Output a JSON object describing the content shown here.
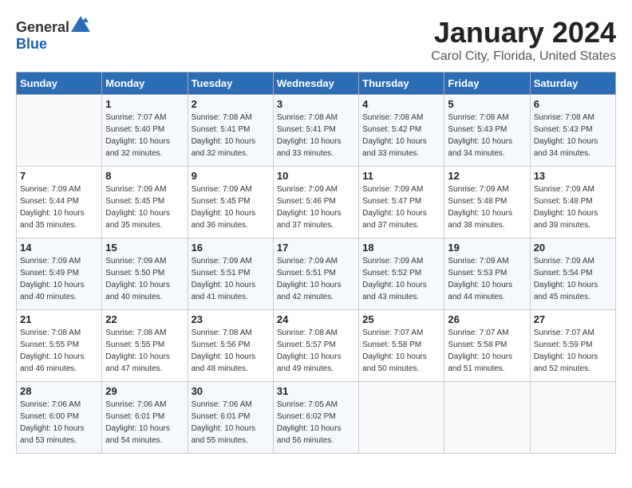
{
  "header": {
    "logo_general": "General",
    "logo_blue": "Blue",
    "month": "January 2024",
    "location": "Carol City, Florida, United States"
  },
  "weekdays": [
    "Sunday",
    "Monday",
    "Tuesday",
    "Wednesday",
    "Thursday",
    "Friday",
    "Saturday"
  ],
  "weeks": [
    [
      {
        "day": "",
        "sunrise": "",
        "sunset": "",
        "daylight": ""
      },
      {
        "day": "1",
        "sunrise": "Sunrise: 7:07 AM",
        "sunset": "Sunset: 5:40 PM",
        "daylight": "Daylight: 10 hours and 32 minutes."
      },
      {
        "day": "2",
        "sunrise": "Sunrise: 7:08 AM",
        "sunset": "Sunset: 5:41 PM",
        "daylight": "Daylight: 10 hours and 32 minutes."
      },
      {
        "day": "3",
        "sunrise": "Sunrise: 7:08 AM",
        "sunset": "Sunset: 5:41 PM",
        "daylight": "Daylight: 10 hours and 33 minutes."
      },
      {
        "day": "4",
        "sunrise": "Sunrise: 7:08 AM",
        "sunset": "Sunset: 5:42 PM",
        "daylight": "Daylight: 10 hours and 33 minutes."
      },
      {
        "day": "5",
        "sunrise": "Sunrise: 7:08 AM",
        "sunset": "Sunset: 5:43 PM",
        "daylight": "Daylight: 10 hours and 34 minutes."
      },
      {
        "day": "6",
        "sunrise": "Sunrise: 7:08 AM",
        "sunset": "Sunset: 5:43 PM",
        "daylight": "Daylight: 10 hours and 34 minutes."
      }
    ],
    [
      {
        "day": "7",
        "sunrise": "Sunrise: 7:09 AM",
        "sunset": "Sunset: 5:44 PM",
        "daylight": "Daylight: 10 hours and 35 minutes."
      },
      {
        "day": "8",
        "sunrise": "Sunrise: 7:09 AM",
        "sunset": "Sunset: 5:45 PM",
        "daylight": "Daylight: 10 hours and 35 minutes."
      },
      {
        "day": "9",
        "sunrise": "Sunrise: 7:09 AM",
        "sunset": "Sunset: 5:45 PM",
        "daylight": "Daylight: 10 hours and 36 minutes."
      },
      {
        "day": "10",
        "sunrise": "Sunrise: 7:09 AM",
        "sunset": "Sunset: 5:46 PM",
        "daylight": "Daylight: 10 hours and 37 minutes."
      },
      {
        "day": "11",
        "sunrise": "Sunrise: 7:09 AM",
        "sunset": "Sunset: 5:47 PM",
        "daylight": "Daylight: 10 hours and 37 minutes."
      },
      {
        "day": "12",
        "sunrise": "Sunrise: 7:09 AM",
        "sunset": "Sunset: 5:48 PM",
        "daylight": "Daylight: 10 hours and 38 minutes."
      },
      {
        "day": "13",
        "sunrise": "Sunrise: 7:09 AM",
        "sunset": "Sunset: 5:48 PM",
        "daylight": "Daylight: 10 hours and 39 minutes."
      }
    ],
    [
      {
        "day": "14",
        "sunrise": "Sunrise: 7:09 AM",
        "sunset": "Sunset: 5:49 PM",
        "daylight": "Daylight: 10 hours and 40 minutes."
      },
      {
        "day": "15",
        "sunrise": "Sunrise: 7:09 AM",
        "sunset": "Sunset: 5:50 PM",
        "daylight": "Daylight: 10 hours and 40 minutes."
      },
      {
        "day": "16",
        "sunrise": "Sunrise: 7:09 AM",
        "sunset": "Sunset: 5:51 PM",
        "daylight": "Daylight: 10 hours and 41 minutes."
      },
      {
        "day": "17",
        "sunrise": "Sunrise: 7:09 AM",
        "sunset": "Sunset: 5:51 PM",
        "daylight": "Daylight: 10 hours and 42 minutes."
      },
      {
        "day": "18",
        "sunrise": "Sunrise: 7:09 AM",
        "sunset": "Sunset: 5:52 PM",
        "daylight": "Daylight: 10 hours and 43 minutes."
      },
      {
        "day": "19",
        "sunrise": "Sunrise: 7:09 AM",
        "sunset": "Sunset: 5:53 PM",
        "daylight": "Daylight: 10 hours and 44 minutes."
      },
      {
        "day": "20",
        "sunrise": "Sunrise: 7:09 AM",
        "sunset": "Sunset: 5:54 PM",
        "daylight": "Daylight: 10 hours and 45 minutes."
      }
    ],
    [
      {
        "day": "21",
        "sunrise": "Sunrise: 7:08 AM",
        "sunset": "Sunset: 5:55 PM",
        "daylight": "Daylight: 10 hours and 46 minutes."
      },
      {
        "day": "22",
        "sunrise": "Sunrise: 7:08 AM",
        "sunset": "Sunset: 5:55 PM",
        "daylight": "Daylight: 10 hours and 47 minutes."
      },
      {
        "day": "23",
        "sunrise": "Sunrise: 7:08 AM",
        "sunset": "Sunset: 5:56 PM",
        "daylight": "Daylight: 10 hours and 48 minutes."
      },
      {
        "day": "24",
        "sunrise": "Sunrise: 7:08 AM",
        "sunset": "Sunset: 5:57 PM",
        "daylight": "Daylight: 10 hours and 49 minutes."
      },
      {
        "day": "25",
        "sunrise": "Sunrise: 7:07 AM",
        "sunset": "Sunset: 5:58 PM",
        "daylight": "Daylight: 10 hours and 50 minutes."
      },
      {
        "day": "26",
        "sunrise": "Sunrise: 7:07 AM",
        "sunset": "Sunset: 5:58 PM",
        "daylight": "Daylight: 10 hours and 51 minutes."
      },
      {
        "day": "27",
        "sunrise": "Sunrise: 7:07 AM",
        "sunset": "Sunset: 5:59 PM",
        "daylight": "Daylight: 10 hours and 52 minutes."
      }
    ],
    [
      {
        "day": "28",
        "sunrise": "Sunrise: 7:06 AM",
        "sunset": "Sunset: 6:00 PM",
        "daylight": "Daylight: 10 hours and 53 minutes."
      },
      {
        "day": "29",
        "sunrise": "Sunrise: 7:06 AM",
        "sunset": "Sunset: 6:01 PM",
        "daylight": "Daylight: 10 hours and 54 minutes."
      },
      {
        "day": "30",
        "sunrise": "Sunrise: 7:06 AM",
        "sunset": "Sunset: 6:01 PM",
        "daylight": "Daylight: 10 hours and 55 minutes."
      },
      {
        "day": "31",
        "sunrise": "Sunrise: 7:05 AM",
        "sunset": "Sunset: 6:02 PM",
        "daylight": "Daylight: 10 hours and 56 minutes."
      },
      {
        "day": "",
        "sunrise": "",
        "sunset": "",
        "daylight": ""
      },
      {
        "day": "",
        "sunrise": "",
        "sunset": "",
        "daylight": ""
      },
      {
        "day": "",
        "sunrise": "",
        "sunset": "",
        "daylight": ""
      }
    ]
  ]
}
